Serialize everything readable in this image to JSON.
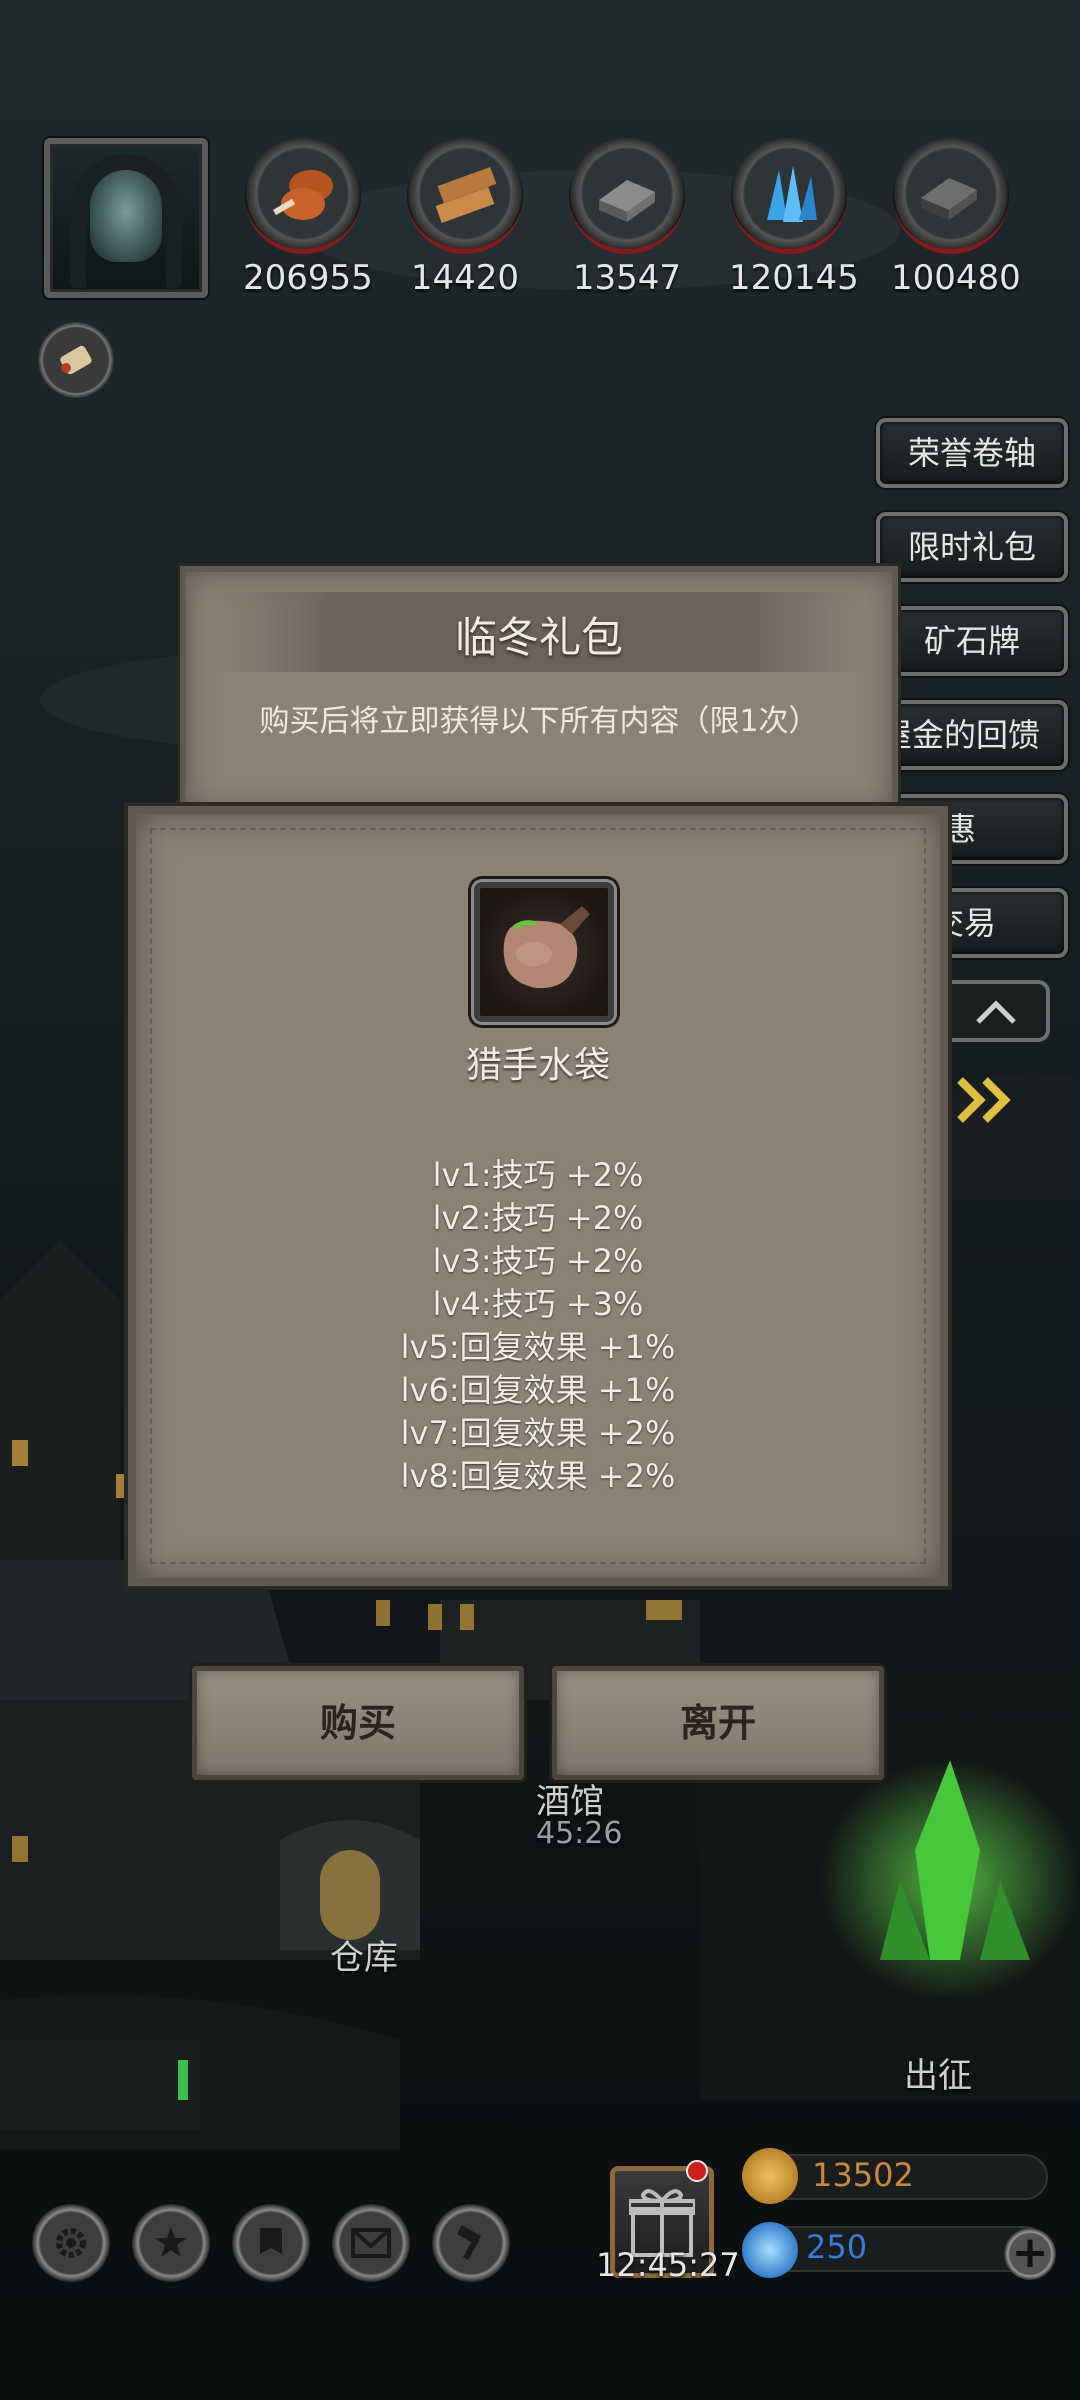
{
  "resources": {
    "meat": "206955",
    "wood": "14420",
    "iron": "13547",
    "crystal": "120145",
    "steel": "100480"
  },
  "side_menu": [
    "荣誉卷轴",
    "限时礼包",
    "矿石牌",
    "屋金的回馈",
    "团特惠",
    "兰交易"
  ],
  "town": {
    "tavern_label": "酒馆",
    "tavern_timer": "45:26",
    "warehouse_label": "仓库",
    "expedition_label": "出征"
  },
  "pack_dialog": {
    "title": "临冬礼包",
    "description": "购买后将立即获得以下所有内容（限1次）"
  },
  "item_dialog": {
    "item_name": "猎手水袋",
    "stats": [
      "lv1:技巧 +2%",
      "lv2:技巧 +2%",
      "lv3:技巧 +2%",
      "lv4:技巧 +3%",
      "lv5:回复效果 +1%",
      "lv6:回复效果 +1%",
      "lv7:回复效果 +2%",
      "lv8:回复效果 +2%"
    ]
  },
  "buttons": {
    "buy": "购买",
    "leave": "离开"
  },
  "bottom": {
    "timer": "12:45:27",
    "gold": "13502",
    "gems": "250",
    "add_symbol": "+"
  },
  "colors": {
    "panel_bg": "#8b8275",
    "gold_text": "#c88a3a",
    "gem_text": "#3a7ad8",
    "alert_red": "#d01c1c"
  }
}
